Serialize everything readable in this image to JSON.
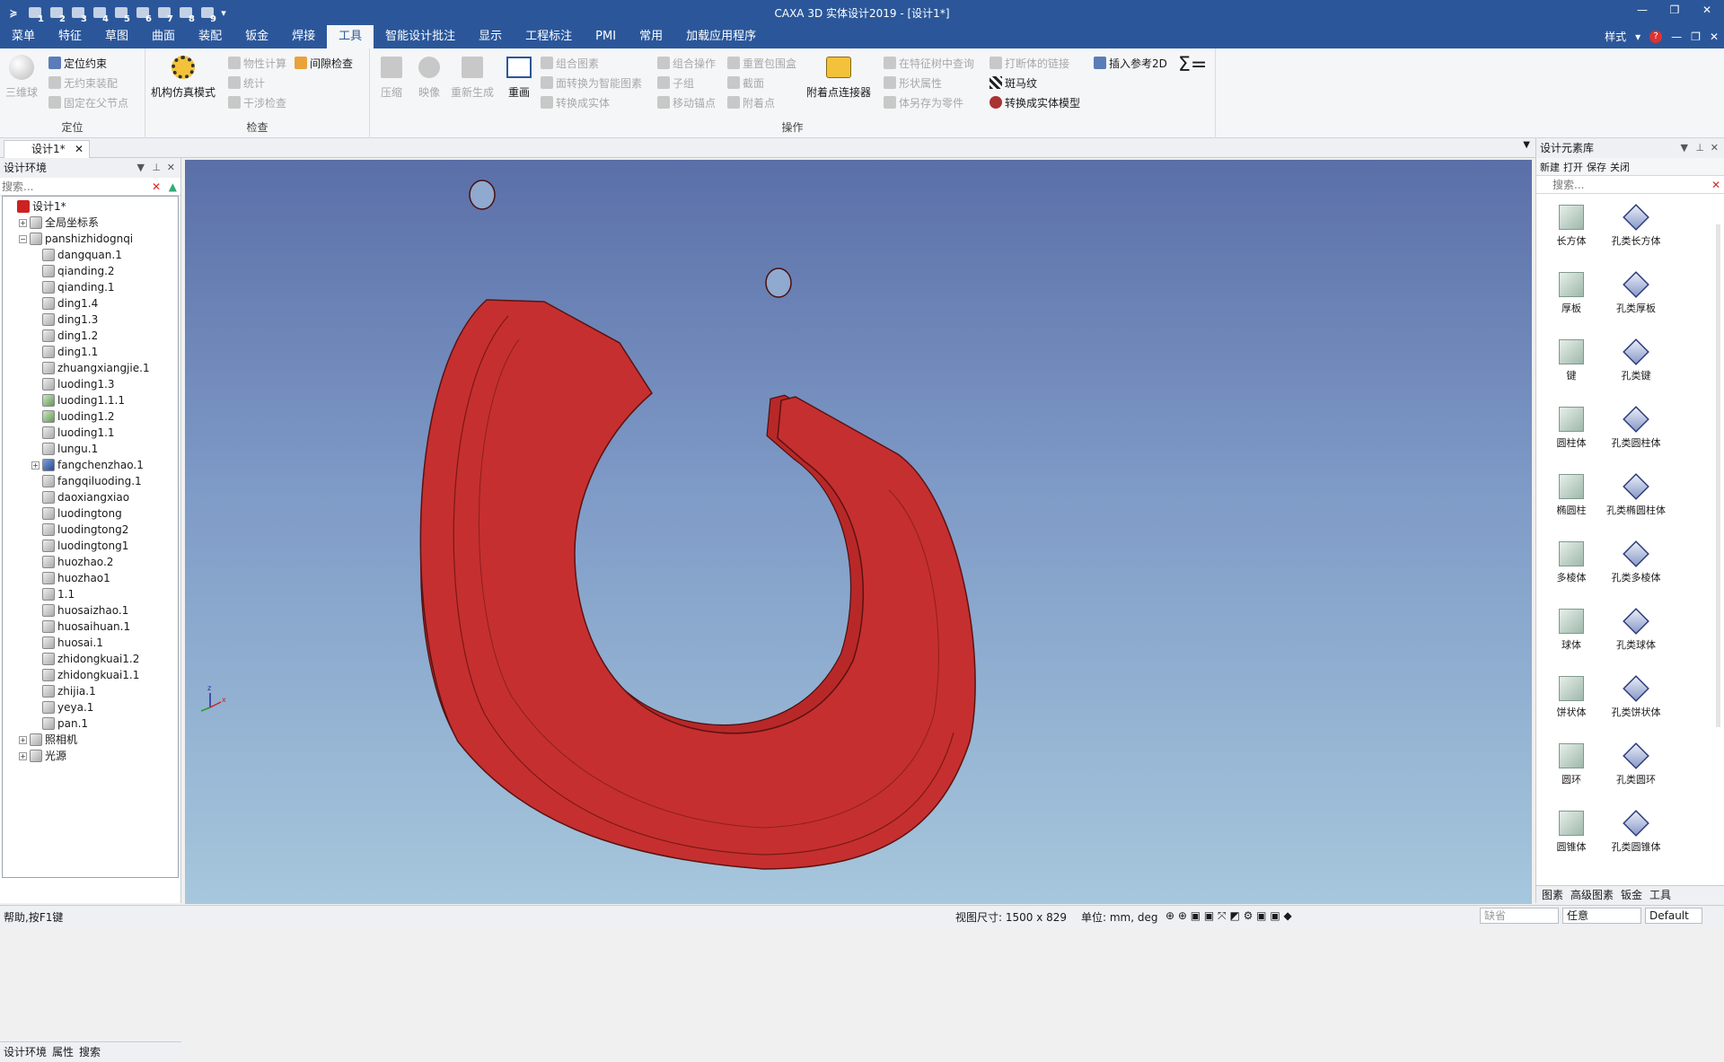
{
  "app_title": "CAXA 3D 实体设计2019 - [设计1*]",
  "quick_access": {
    "numbers": [
      "1",
      "2",
      "3",
      "4",
      "5",
      "6",
      "7",
      "8",
      "9"
    ]
  },
  "window_controls": {
    "min": "—",
    "max": "❐",
    "close": "✕"
  },
  "menubar": {
    "items": [
      "菜单",
      "特征",
      "草图",
      "曲面",
      "装配",
      "钣金",
      "焊接",
      "工具",
      "智能设计批注",
      "显示",
      "工程标注",
      "PMI",
      "常用",
      "加载应用程序"
    ],
    "active": "工具",
    "style_label": "样式",
    "help_icon": "?",
    "inner_min": "—",
    "inner_restore": "❐",
    "inner_close": "✕"
  },
  "ribbon": {
    "groups": {
      "locate": "定位",
      "check": "检查",
      "operate": "操作"
    },
    "locate": {
      "ball": "三维球",
      "constraint": "定位约束",
      "free_assemble": "无约束装配",
      "fix_parent": "固定在父节点"
    },
    "mech": {
      "sim_mode": "机构仿真模式"
    },
    "check": {
      "properties": "物性计算",
      "stats": "统计",
      "interference": "干涉检查",
      "clearance": "间隙检查"
    },
    "operate": {
      "compress": "压缩",
      "mirror": "映像",
      "regenerate": "重新生成",
      "redraw": "重画",
      "combine_elem": "组合图素",
      "to_smart": "面转换为智能图素",
      "to_solid": "转换成实体",
      "combine_op": "组合操作",
      "subgroup": "子组",
      "move_anchor": "移动锚点",
      "reset_bbox": "重置包围盒",
      "section": "截面",
      "attach_point": "附着点",
      "attach_connector": "附着点连接器",
      "find_in_tree": "在特征树中查询",
      "shape_attr": "形状属性",
      "save_as_part": "体另存为零件",
      "break_link": "打断体的链接",
      "zebra": "斑马纹",
      "to_solid_model": "转换成实体模型",
      "insert_ref2d": "插入参考2D",
      "formula": "Σ="
    }
  },
  "doc_tabs": {
    "active": "设计1*",
    "close": "✕"
  },
  "left_panel": {
    "title": "设计环境",
    "search_placeholder": "搜索...",
    "tree": {
      "root": "设计1*",
      "global_coords": "全局坐标系",
      "assembly": "panshizhidognqi",
      "parts": [
        "dangquan.1",
        "qianding.2",
        "qianding.1",
        "ding1.4",
        "ding1.3",
        "ding1.2",
        "ding1.1",
        "zhuangxiangjie.1",
        "luoding1.3",
        "luoding1.1.1",
        "luoding1.2",
        "luoding1.1",
        "lungu.1",
        "fangchenzhao.1",
        "fangqiluoding.1",
        "daoxiangxiao",
        "luodingtong",
        "luodingtong2",
        "luodingtong1",
        "huozhao.2",
        "huozhao1",
        "1.1",
        "huosaizhao.1",
        "huosaihuan.1",
        "huosai.1",
        "zhidongkuai1.2",
        "zhidongkuai1.1",
        "zhijia.1",
        "yeya.1",
        "pan.1"
      ],
      "camera": "照相机",
      "light": "光源"
    },
    "bottom_tabs": [
      "设计环境",
      "属性",
      "搜索"
    ]
  },
  "right_panel": {
    "title": "设计元素库",
    "toolbar": [
      "新建",
      "打开",
      "保存",
      "关闭"
    ],
    "search_placeholder": "搜索...",
    "items": [
      [
        "长方体",
        "孔类长方体"
      ],
      [
        "厚板",
        "孔类厚板"
      ],
      [
        "键",
        "孔类键"
      ],
      [
        "圆柱体",
        "孔类圆柱体"
      ],
      [
        "椭圆柱",
        "孔类椭圆柱体"
      ],
      [
        "多棱体",
        "孔类多棱体"
      ],
      [
        "球体",
        "孔类球体"
      ],
      [
        "饼状体",
        "孔类饼状体"
      ],
      [
        "圆环",
        "孔类圆环"
      ],
      [
        "圆锥体",
        "孔类圆锥体"
      ]
    ],
    "bottom_tabs": [
      "图素",
      "高级图素",
      "钣金",
      "工具"
    ]
  },
  "status": {
    "help": "帮助,按F1键",
    "view_size": "视图尺寸: 1500 x 829",
    "units": "单位: mm, deg",
    "filter1": "缺省",
    "filter2": "任意",
    "filter3": "Default"
  },
  "colors": {
    "titlebar": "#2b579a",
    "part_red": "#c62f2f",
    "part_edge": "#6b1414"
  }
}
